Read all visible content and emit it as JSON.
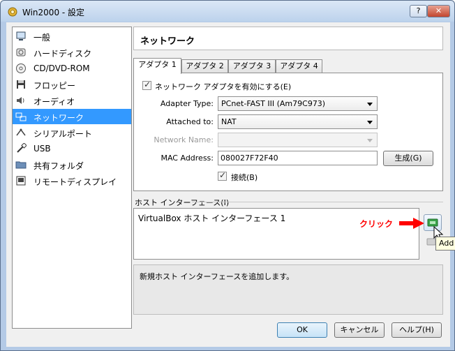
{
  "window": {
    "title": "Win2000 - 設定",
    "help_button": "?",
    "close_button": "✕"
  },
  "sidebar": {
    "items": [
      {
        "label": "一般",
        "icon": "monitor-icon",
        "selected": false
      },
      {
        "label": "ハードディスク",
        "icon": "harddisk-icon",
        "selected": false
      },
      {
        "label": "CD/DVD-ROM",
        "icon": "cd-icon",
        "selected": false
      },
      {
        "label": "フロッピー",
        "icon": "floppy-icon",
        "selected": false
      },
      {
        "label": "オーディオ",
        "icon": "audio-icon",
        "selected": false
      },
      {
        "label": "ネットワーク",
        "icon": "network-icon",
        "selected": true
      },
      {
        "label": "シリアルポート",
        "icon": "serial-icon",
        "selected": false
      },
      {
        "label": "USB",
        "icon": "usb-icon",
        "selected": false
      },
      {
        "label": "共有フォルダ",
        "icon": "folder-icon",
        "selected": false
      },
      {
        "label": "リモートディスプレイ",
        "icon": "remote-display-icon",
        "selected": false
      }
    ]
  },
  "main": {
    "section_title": "ネットワーク",
    "tabs": [
      {
        "label": "アダプタ 1",
        "active": true
      },
      {
        "label": "アダプタ 2",
        "active": false
      },
      {
        "label": "アダプタ 3",
        "active": false
      },
      {
        "label": "アダプタ 4",
        "active": false
      }
    ],
    "enable_checkbox": {
      "label": "ネットワーク アダプタを有効にする(E)",
      "checked": true
    },
    "adapter_type": {
      "label": "Adapter Type:",
      "value": "PCnet-FAST III (Am79C973)"
    },
    "attached_to": {
      "label": "Attached to:",
      "value": "NAT"
    },
    "network_name": {
      "label": "Network Name:",
      "value": "",
      "disabled": true
    },
    "mac_address": {
      "label": "MAC Address:",
      "value": "080027F72F40",
      "generate_button": "生成(G)"
    },
    "cable_checkbox": {
      "label": "接続(B)",
      "checked": true
    },
    "host_interface": {
      "group_label": "ホスト インターフェース(I)",
      "items": [
        "VirtualBox ホスト インターフェース 1"
      ],
      "annotation": "クリック",
      "tooltip": "Add"
    },
    "description": "新規ホスト インターフェースを追加します。"
  },
  "footer": {
    "ok": "OK",
    "cancel": "キャンセル",
    "help": "ヘルプ(H)"
  },
  "colors": {
    "selection": "#3399ff",
    "annotation_red": "#ff0000",
    "ok_border": "#3c7fb1"
  }
}
